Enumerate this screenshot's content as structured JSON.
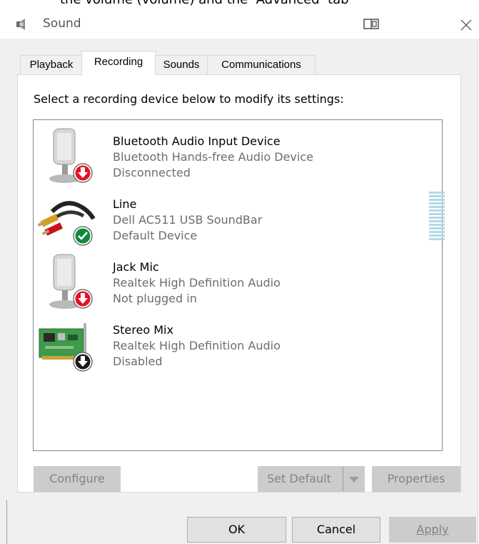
{
  "top_fragment": "the volume (volume) and the ‘Advanced’ tab",
  "window": {
    "title": "Sound"
  },
  "tabs": [
    {
      "label": "Playback"
    },
    {
      "label": "Recording"
    },
    {
      "label": "Sounds"
    },
    {
      "label": "Communications"
    }
  ],
  "instruction": "Select a recording device below to modify its settings:",
  "devices": [
    {
      "name": "Bluetooth Audio Input Device",
      "description": "Bluetooth Hands-free Audio Device",
      "status": "Disconnected",
      "icon": "microphone-icon",
      "badge": "red-down-arrow"
    },
    {
      "name": "Line",
      "description": "Dell AC511 USB SoundBar",
      "status": "Default Device",
      "icon": "rca-cable-icon",
      "badge": "green-check",
      "level": 0
    },
    {
      "name": "Jack Mic",
      "description": "Realtek High Definition Audio",
      "status": "Not plugged in",
      "icon": "microphone-icon",
      "badge": "red-down-arrow"
    },
    {
      "name": "Stereo Mix",
      "description": "Realtek High Definition Audio",
      "status": "Disabled",
      "icon": "sound-card-icon",
      "badge": "black-down-arrow"
    }
  ],
  "buttons": {
    "configure": "Configure",
    "set_default": "Set Default",
    "properties": "Properties",
    "ok": "OK",
    "cancel": "Cancel",
    "apply": "Apply"
  },
  "colors": {
    "accent_disabled": "#cccccc",
    "badge_red": "#e81123",
    "badge_green": "#10893e",
    "meter": "#b3d9e6"
  }
}
